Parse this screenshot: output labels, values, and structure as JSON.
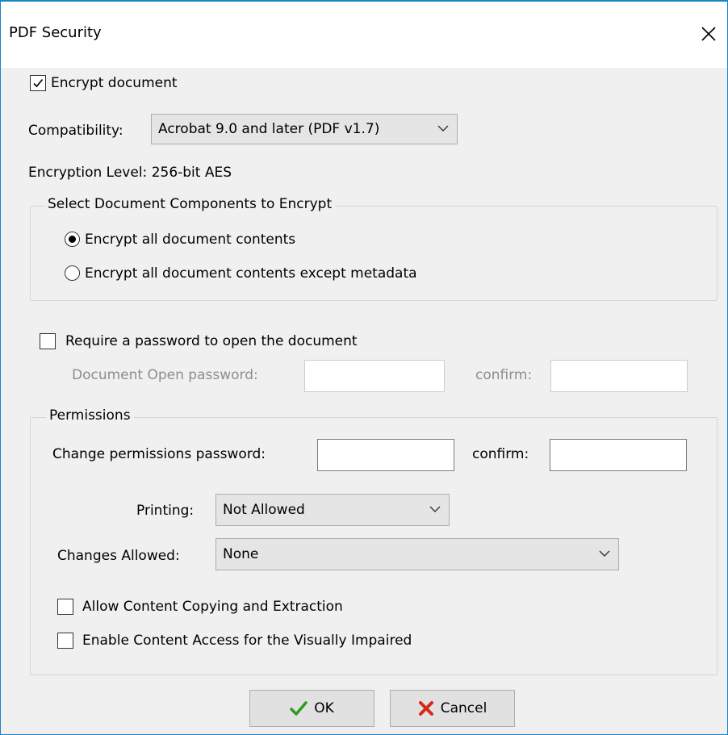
{
  "window": {
    "title": "PDF Security"
  },
  "encrypt": {
    "label": "Encrypt document",
    "checked": true
  },
  "compatibility": {
    "label": "Compatibility:",
    "value": "Acrobat 9.0 and later (PDF v1.7)"
  },
  "encryption_level": {
    "label": "Encryption Level:",
    "value": "256-bit AES"
  },
  "components": {
    "title": "Select Document Components to Encrypt",
    "options": [
      {
        "label": "Encrypt all document contents",
        "selected": true
      },
      {
        "label": "Encrypt all document contents except metadata",
        "selected": false
      }
    ]
  },
  "open_password": {
    "require_label": "Require a password to open the document",
    "checked": false,
    "field_label": "Document Open password:",
    "confirm_label": "confirm:",
    "value": "",
    "confirm_value": ""
  },
  "permissions": {
    "title": "Permissions",
    "change_label": "Change permissions password:",
    "confirm_label": "confirm:",
    "value": "",
    "confirm_value": "",
    "printing_label": "Printing:",
    "printing_value": "Not Allowed",
    "changes_label": "Changes Allowed:",
    "changes_value": "None",
    "copying_label": "Allow Content Copying and Extraction",
    "copying_checked": false,
    "access_label": "Enable Content Access for the Visually Impaired",
    "access_checked": false
  },
  "buttons": {
    "ok": "OK",
    "cancel": "Cancel"
  },
  "icons": {
    "close": "close-icon",
    "chevron": "chevron-down-icon",
    "ok": "checkmark-icon",
    "cancel": "x-icon"
  },
  "colors": {
    "window_border": "#1a84c6",
    "ok_icon": "#2e9a1e",
    "cancel_icon": "#d42a1c"
  }
}
